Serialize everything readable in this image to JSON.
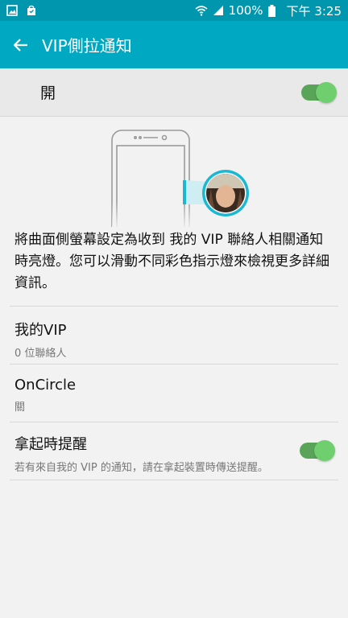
{
  "status": {
    "battery_pct": "100%",
    "time": "下午 3:25"
  },
  "header": {
    "title": "VIP側拉通知"
  },
  "master": {
    "label": "開",
    "enabled": true
  },
  "description": "將曲面側螢幕設定為收到 我的 VIP 聯絡人相關通知時亮燈。您可以滑動不同彩色指示燈來檢視更多詳細資訊。",
  "items": [
    {
      "title": "我的VIP",
      "subtitle": "0 位聯絡人"
    },
    {
      "title": "OnCircle",
      "subtitle": "關"
    },
    {
      "title": "拿起時提醒",
      "subtitle": "若有來自我的 VIP 的通知，請在拿起裝置時傳送提醒。",
      "enabled": true
    }
  ],
  "colors": {
    "statusbar": "#0096ad",
    "appbar": "#00a8c2",
    "toggle_track": "#5aa45a",
    "toggle_knob": "#6fcf6f",
    "edge_light": "#1ab8d2"
  }
}
